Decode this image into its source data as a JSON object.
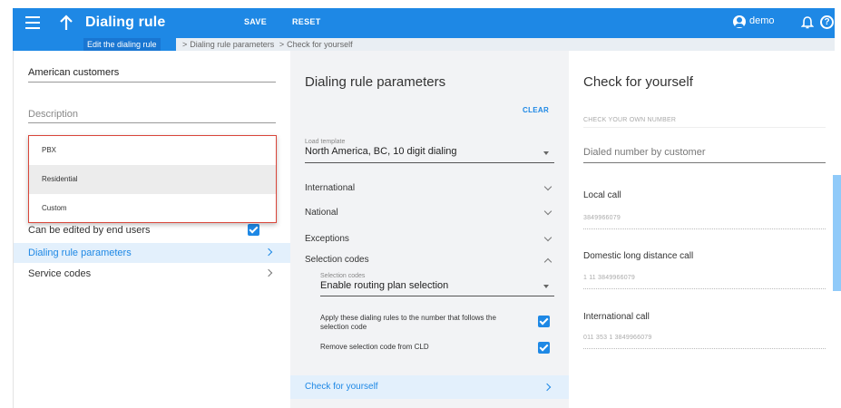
{
  "header": {
    "title": "Dialing rule",
    "save_label": "SAVE",
    "reset_label": "RESET",
    "user_name": "demo",
    "help_glyph": "?"
  },
  "breadcrumb": {
    "items": [
      "Edit the dialing rule",
      "Dialing rule parameters",
      "Check for yourself"
    ],
    "separator": ">"
  },
  "left": {
    "name_value": "American customers",
    "description_placeholder": "Description",
    "dropdown_options": [
      "PBX",
      "Residential",
      "Custom"
    ],
    "dropdown_selected": "Residential",
    "editable_label": "Can be edited by end users",
    "editable_checked": true,
    "nav": [
      "Dialing rule parameters",
      "Service codes"
    ]
  },
  "middle": {
    "title": "Dialing rule parameters",
    "clear_label": "CLEAR",
    "template_label": "Load template",
    "template_value": "North America, BC, 10 digit dialing",
    "sections": [
      "International",
      "National",
      "Exceptions",
      "Selection codes"
    ],
    "selection_codes_label": "Selection codes",
    "selection_codes_value": "Enable routing plan selection",
    "apply_rules_label": "Apply these dialing rules to the number that follows the selection code",
    "apply_rules_checked": true,
    "remove_code_label": "Remove selection code from CLD",
    "remove_code_checked": true,
    "check_link": "Check for yourself"
  },
  "right": {
    "title": "Check for yourself",
    "check_own_label": "CHECK YOUR OWN NUMBER",
    "dialed_placeholder": "Dialed number by customer",
    "local_label": "Local call",
    "local_value": "3849966079",
    "domestic_label": "Domestic long distance call",
    "domestic_value": "1 11 3849966079",
    "international_label": "International call",
    "international_value": "011 353 1 3849966079"
  },
  "colors": {
    "accent": "#1e88e5",
    "dropdown_border": "#d9463a"
  }
}
